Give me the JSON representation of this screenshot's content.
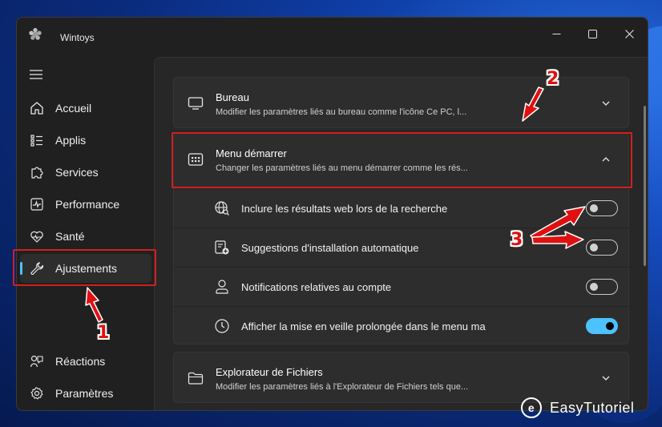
{
  "window": {
    "title": "Wintoys",
    "controls": {
      "minimize": "─",
      "maximize": "☐",
      "close": "✕"
    }
  },
  "sidebar": {
    "items": [
      {
        "label": "Accueil",
        "icon": "home-icon"
      },
      {
        "label": "Applis",
        "icon": "apps-list-icon"
      },
      {
        "label": "Services",
        "icon": "puzzle-icon"
      },
      {
        "label": "Performance",
        "icon": "performance-icon"
      },
      {
        "label": "Santé",
        "icon": "health-icon"
      },
      {
        "label": "Ajustements",
        "icon": "wrench-icon",
        "active": true
      },
      {
        "label": "Réactions",
        "icon": "feedback-icon"
      },
      {
        "label": "Paramètres",
        "icon": "gear-icon"
      }
    ]
  },
  "cards": {
    "bureau": {
      "title": "Bureau",
      "subtitle": "Modifier les paramètres liés au bureau comme l'icône Ce PC, l...",
      "icon": "monitor-icon"
    },
    "menu": {
      "title": "Menu démarrer",
      "subtitle": "Changer les paramètres liés au menu démarrer comme les rés...",
      "icon": "start-menu-icon",
      "settings": [
        {
          "label": "Inclure les résultats web lors de la recherche",
          "icon": "globe-search-icon",
          "on": false
        },
        {
          "label": "Suggestions d'installation automatique",
          "icon": "install-suggest-icon",
          "on": false
        },
        {
          "label": "Notifications relatives au compte",
          "icon": "person-icon",
          "on": false
        },
        {
          "label": "Afficher la mise en veille prolongée dans le menu ma",
          "icon": "clock-icon",
          "on": true
        }
      ]
    },
    "explorer": {
      "title": "Explorateur de Fichiers",
      "subtitle": "Modifier les paramètres liés à l'Explorateur de Fichiers tels que...",
      "icon": "folder-icon"
    }
  },
  "annotations": {
    "n1": "1",
    "n2": "2",
    "n3": "3",
    "color": "#d11f1f"
  },
  "watermark": {
    "logo_letter": "e",
    "text": "EasyTutoriel"
  },
  "colors": {
    "accent": "#4cc2ff",
    "window_bg": "#202020",
    "card_bg": "#2d2d2d"
  }
}
